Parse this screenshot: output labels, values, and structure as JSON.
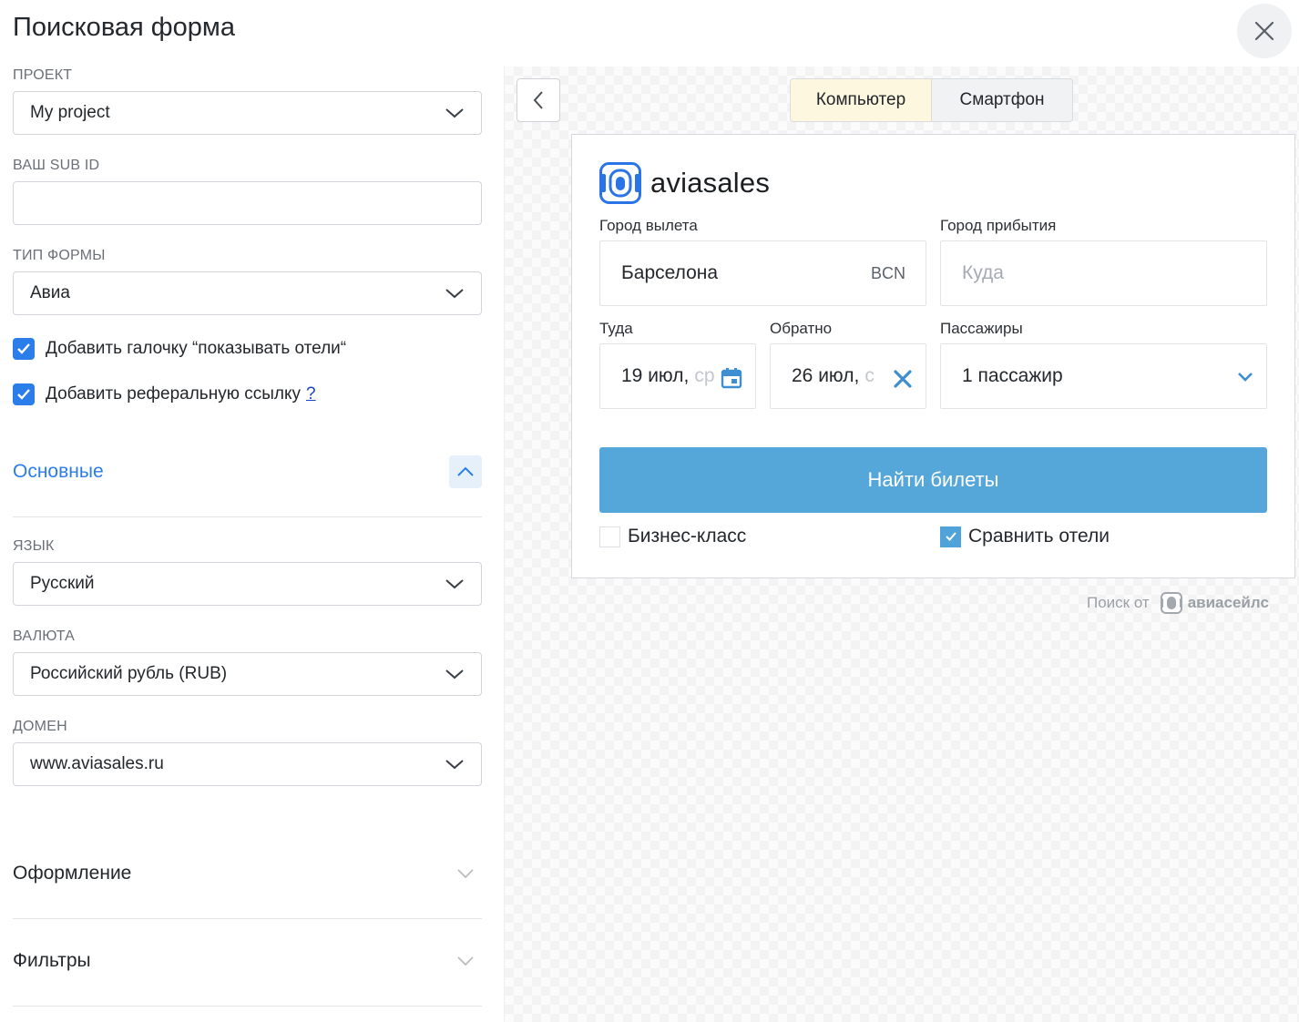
{
  "title": "Поисковая форма",
  "left": {
    "project": {
      "label": "ПРОЕКТ",
      "value": "My project"
    },
    "sub_id": {
      "label": "ВАШ SUB ID",
      "value": ""
    },
    "form_type": {
      "label": "ТИП ФОРМЫ",
      "value": "Авиа"
    },
    "checkbox_hotels": {
      "label": "Добавить галочку “показывать отели“",
      "checked": true
    },
    "checkbox_referral": {
      "label": "Добавить реферальную ссылку",
      "help": "?",
      "checked": true
    },
    "main_section": {
      "title": "Основные",
      "expanded": true,
      "color": "#2b7de9"
    },
    "language": {
      "label": "ЯЗЫК",
      "value": "Русский"
    },
    "currency": {
      "label": "ВАЛЮТА",
      "value": "Российский рубль (RUB)"
    },
    "domain": {
      "label": "ДОМЕН",
      "value": "www.aviasales.ru"
    },
    "design_section": {
      "title": "Оформление",
      "expanded": false
    },
    "filters_section": {
      "title": "Фильтры",
      "expanded": false
    }
  },
  "preview": {
    "tabs": [
      {
        "label": "Компьютер",
        "active": true
      },
      {
        "label": "Смартфон",
        "active": false
      }
    ],
    "widget": {
      "brand": "aviasales",
      "origin": {
        "label": "Город вылета",
        "value": "Барселона",
        "code": "BCN"
      },
      "destination": {
        "label": "Город прибытия",
        "placeholder": "Куда"
      },
      "depart": {
        "label": "Туда",
        "value": "19 июл,",
        "weekday": "ср"
      },
      "return": {
        "label": "Обратно",
        "value": "26 июл,",
        "weekday": "с"
      },
      "passengers": {
        "label": "Пассажиры",
        "value": "1 пассажир"
      },
      "search_button": "Найти билеты",
      "business_class": {
        "label": "Бизнес-класс",
        "checked": false
      },
      "compare_hotels": {
        "label": "Сравнить отели",
        "checked": true
      }
    },
    "powered_by": {
      "text": "Поиск от",
      "brand": "авиасейлс"
    }
  }
}
